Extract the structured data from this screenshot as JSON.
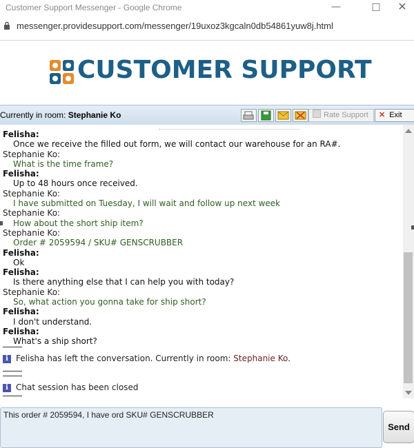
{
  "window": {
    "title": "Customer Support Messenger - Google Chrome",
    "minimize_icon": "minimize-icon",
    "maximize_icon": "maximize-icon",
    "close_icon": "close-icon"
  },
  "address": {
    "url": "messenger.providesupport.com/messenger/19uxoz3kgcaln0db54861yuw8j.html",
    "lock_icon": "lock-icon"
  },
  "header": {
    "logo_text": "CUSTOMER SUPPORT",
    "brand_color": "#1d5f86",
    "logo_icon": "support-logo-icon"
  },
  "roombar": {
    "label": "Currently in room:",
    "room_name": "Stephanie Ko",
    "rate_label": "Rate Support",
    "exit_label": "Exit",
    "tools": [
      "print-icon",
      "save-icon",
      "email-icon",
      "sound-icon"
    ]
  },
  "chat": {
    "messages": [
      {
        "sender": "Felisha:",
        "text": "Once we receive the filled out form, we will contact our warehouse for an RA#.",
        "role": "agent"
      },
      {
        "sender": "Stephanie Ko:",
        "text": "What is the time frame?",
        "role": "user"
      },
      {
        "sender": "Felisha:",
        "text": "Up to 48 hours once received.",
        "role": "agent"
      },
      {
        "sender": "Stephanie Ko:",
        "text": "I have submitted on Tuesday, I will wait and follow up next week",
        "role": "user"
      },
      {
        "sender": "Stephanie Ko:",
        "text": "How about the short ship item?",
        "role": "user"
      },
      {
        "sender": "Stephanie Ko:",
        "text": "Order # 2059594 / SKU# GENSCRUBBER",
        "role": "user"
      },
      {
        "sender": "Felisha:",
        "text": "Ok",
        "role": "agent"
      },
      {
        "sender": "Felisha:",
        "text": "Is there anything else that I can help you with today?",
        "role": "agent"
      },
      {
        "sender": "Stephanie Ko:",
        "text": "So, what action you gonna take for ship short?",
        "role": "user"
      },
      {
        "sender": "Felisha:",
        "text": "I don't understand.",
        "role": "agent"
      },
      {
        "sender": "Felisha:",
        "text": "What's a ship short?",
        "role": "agent"
      }
    ],
    "system1": {
      "pre": "Felisha",
      "mid": " has left the conversation. Currently in room: ",
      "room": "Stephanie Ko",
      "post": "."
    },
    "system2": {
      "text": "Chat session has been closed"
    },
    "info_icon": "info-icon"
  },
  "composer": {
    "value": "This order  # 2059594, I have ord SKU# GENSCRUBBER",
    "send_label": "Send"
  }
}
